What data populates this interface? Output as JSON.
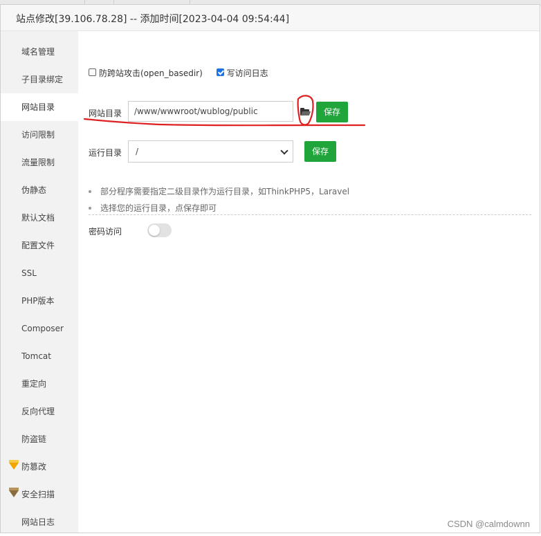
{
  "window": {
    "title": "站点修改[39.106.78.28] -- 添加时间[2023-04-04 09:54:44]"
  },
  "sidebar": {
    "items": [
      {
        "label": "域名管理"
      },
      {
        "label": "子目录绑定"
      },
      {
        "label": "网站目录",
        "active": true
      },
      {
        "label": "访问限制"
      },
      {
        "label": "流量限制"
      },
      {
        "label": "伪静态"
      },
      {
        "label": "默认文档"
      },
      {
        "label": "配置文件"
      },
      {
        "label": "SSL"
      },
      {
        "label": "PHP版本"
      },
      {
        "label": "Composer"
      },
      {
        "label": "Tomcat"
      },
      {
        "label": "重定向"
      },
      {
        "label": "反向代理"
      },
      {
        "label": "防盗链"
      },
      {
        "label": "防篡改",
        "icon": "gold-gem-icon"
      },
      {
        "label": "安全扫描",
        "icon": "bronze-gem-icon"
      },
      {
        "label": "网站日志"
      }
    ]
  },
  "options": {
    "anti_cross_site": {
      "label": "防跨站攻击(open_basedir)",
      "checked": false
    },
    "access_log": {
      "label": "写访问日志",
      "checked": true
    }
  },
  "site_dir": {
    "label": "网站目录",
    "value": "/www/wwwroot/wublog/public",
    "save_label": "保存",
    "folder_icon": "folder-open-icon"
  },
  "run_dir": {
    "label": "运行目录",
    "value": "/",
    "save_label": "保存"
  },
  "tips": [
    "部分程序需要指定二级目录作为运行目录，如ThinkPHP5，Laravel",
    "选择您的运行目录，点保存即可"
  ],
  "password_access": {
    "label": "密码访问",
    "enabled": false
  },
  "watermark": "CSDN @calmdownn",
  "colors": {
    "accent_green": "#20a53a",
    "checkbox_blue": "#1a73e8",
    "annotation_red": "#e02020"
  }
}
